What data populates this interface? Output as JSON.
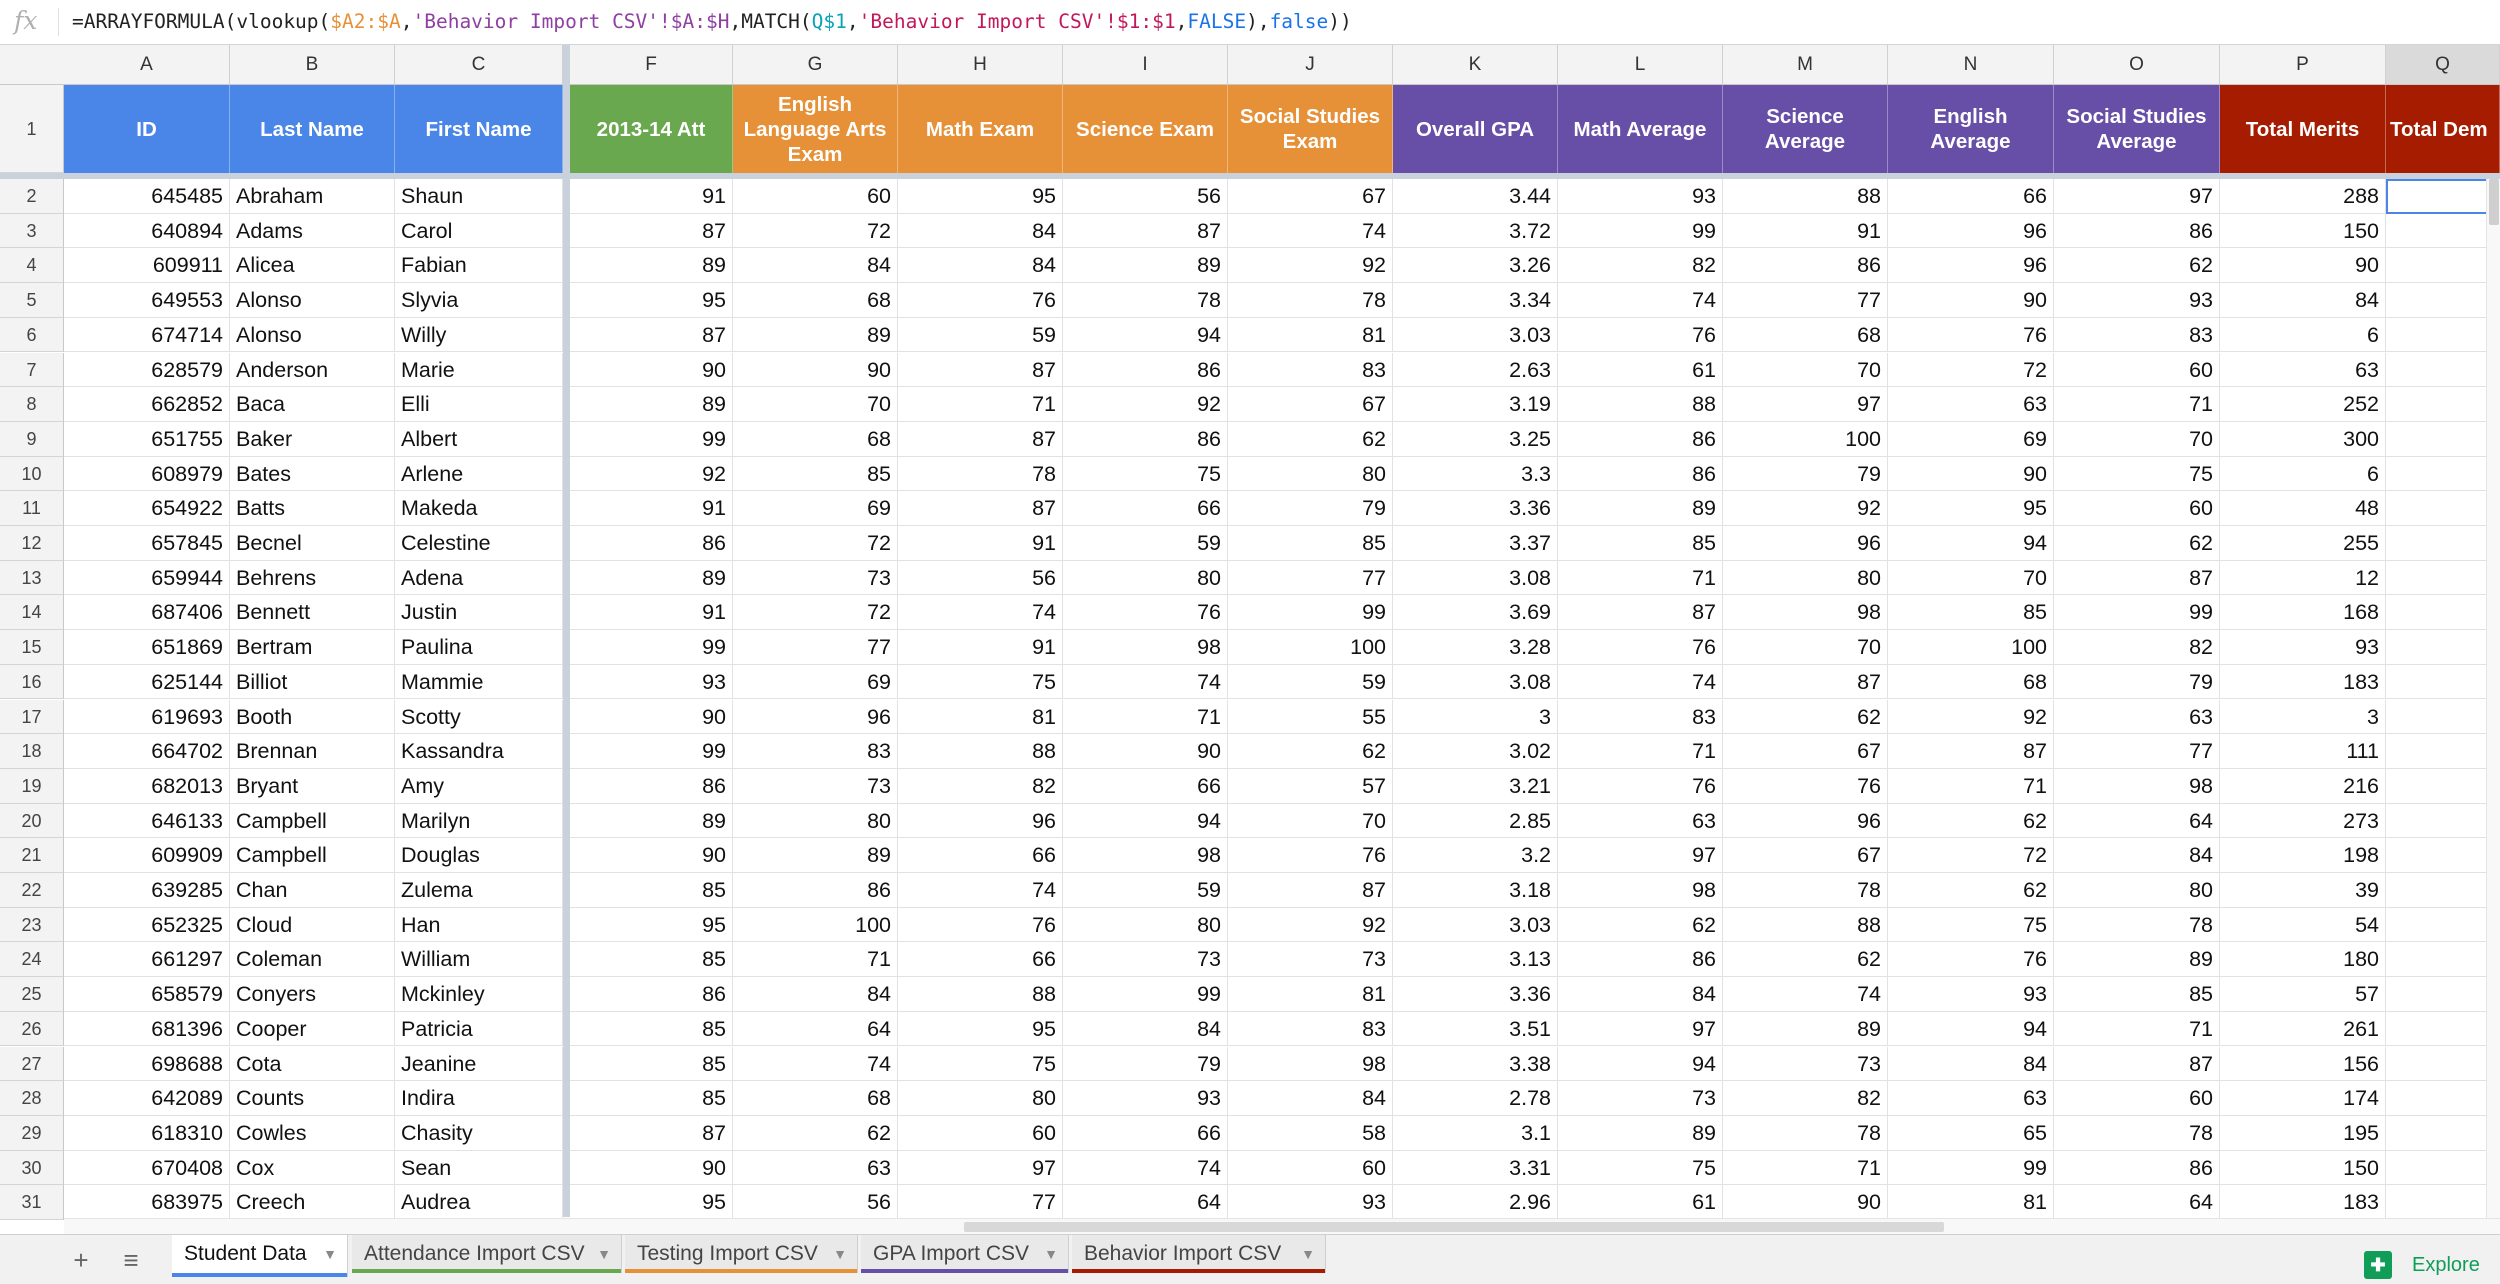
{
  "formula": "=ARRAYFORMULA(vlookup($A2:$A,'Behavior Import CSV'!$A:$H,MATCH(Q$1,'Behavior Import CSV'!$1:$1,FALSE),false))",
  "fx_label": "fx",
  "columns": [
    {
      "letter": "A",
      "header": "ID",
      "color": "#4a86e8"
    },
    {
      "letter": "B",
      "header": "Last Name",
      "color": "#4a86e8"
    },
    {
      "letter": "C",
      "header": "First Name",
      "color": "#4a86e8"
    },
    {
      "letter": "F",
      "header": "2013-14 Att",
      "color": "#6aa84f"
    },
    {
      "letter": "G",
      "header": "English Language Arts Exam",
      "color": "#e69138"
    },
    {
      "letter": "H",
      "header": "Math Exam",
      "color": "#e69138"
    },
    {
      "letter": "I",
      "header": "Science Exam",
      "color": "#e69138"
    },
    {
      "letter": "J",
      "header": "Social Studies Exam",
      "color": "#e69138"
    },
    {
      "letter": "K",
      "header": "Overall GPA",
      "color": "#674ea7"
    },
    {
      "letter": "L",
      "header": "Math Average",
      "color": "#674ea7"
    },
    {
      "letter": "M",
      "header": "Science Average",
      "color": "#674ea7"
    },
    {
      "letter": "N",
      "header": "English Average",
      "color": "#674ea7"
    },
    {
      "letter": "O",
      "header": "Social Studies Average",
      "color": "#674ea7"
    },
    {
      "letter": "P",
      "header": "Total Merits",
      "color": "#a61c00"
    },
    {
      "letter": "Q",
      "header": "Total Dem",
      "color": "#a61c00"
    }
  ],
  "rows": [
    {
      "n": "2",
      "d": [
        "645485",
        "Abraham",
        "Shaun",
        "91",
        "60",
        "95",
        "56",
        "67",
        "3.44",
        "93",
        "88",
        "66",
        "97",
        "288",
        ""
      ]
    },
    {
      "n": "3",
      "d": [
        "640894",
        "Adams",
        "Carol",
        "87",
        "72",
        "84",
        "87",
        "74",
        "3.72",
        "99",
        "91",
        "96",
        "86",
        "150",
        ""
      ]
    },
    {
      "n": "4",
      "d": [
        "609911",
        "Alicea",
        "Fabian",
        "89",
        "84",
        "84",
        "89",
        "92",
        "3.26",
        "82",
        "86",
        "96",
        "62",
        "90",
        ""
      ]
    },
    {
      "n": "5",
      "d": [
        "649553",
        "Alonso",
        "Slyvia",
        "95",
        "68",
        "76",
        "78",
        "78",
        "3.34",
        "74",
        "77",
        "90",
        "93",
        "84",
        ""
      ]
    },
    {
      "n": "6",
      "d": [
        "674714",
        "Alonso",
        "Willy",
        "87",
        "89",
        "59",
        "94",
        "81",
        "3.03",
        "76",
        "68",
        "76",
        "83",
        "6",
        ""
      ]
    },
    {
      "n": "7",
      "d": [
        "628579",
        "Anderson",
        "Marie",
        "90",
        "90",
        "87",
        "86",
        "83",
        "2.63",
        "61",
        "70",
        "72",
        "60",
        "63",
        ""
      ]
    },
    {
      "n": "8",
      "d": [
        "662852",
        "Baca",
        "Elli",
        "89",
        "70",
        "71",
        "92",
        "67",
        "3.19",
        "88",
        "97",
        "63",
        "71",
        "252",
        ""
      ]
    },
    {
      "n": "9",
      "d": [
        "651755",
        "Baker",
        "Albert",
        "99",
        "68",
        "87",
        "86",
        "62",
        "3.25",
        "86",
        "100",
        "69",
        "70",
        "300",
        ""
      ]
    },
    {
      "n": "10",
      "d": [
        "608979",
        "Bates",
        "Arlene",
        "92",
        "85",
        "78",
        "75",
        "80",
        "3.3",
        "86",
        "79",
        "90",
        "75",
        "6",
        ""
      ]
    },
    {
      "n": "11",
      "d": [
        "654922",
        "Batts",
        "Makeda",
        "91",
        "69",
        "87",
        "66",
        "79",
        "3.36",
        "89",
        "92",
        "95",
        "60",
        "48",
        ""
      ]
    },
    {
      "n": "12",
      "d": [
        "657845",
        "Becnel",
        "Celestine",
        "86",
        "72",
        "91",
        "59",
        "85",
        "3.37",
        "85",
        "96",
        "94",
        "62",
        "255",
        ""
      ]
    },
    {
      "n": "13",
      "d": [
        "659944",
        "Behrens",
        "Adena",
        "89",
        "73",
        "56",
        "80",
        "77",
        "3.08",
        "71",
        "80",
        "70",
        "87",
        "12",
        ""
      ]
    },
    {
      "n": "14",
      "d": [
        "687406",
        "Bennett",
        "Justin",
        "91",
        "72",
        "74",
        "76",
        "99",
        "3.69",
        "87",
        "98",
        "85",
        "99",
        "168",
        ""
      ]
    },
    {
      "n": "15",
      "d": [
        "651869",
        "Bertram",
        "Paulina",
        "99",
        "77",
        "91",
        "98",
        "100",
        "3.28",
        "76",
        "70",
        "100",
        "82",
        "93",
        ""
      ]
    },
    {
      "n": "16",
      "d": [
        "625144",
        "Billiot",
        "Mammie",
        "93",
        "69",
        "75",
        "74",
        "59",
        "3.08",
        "74",
        "87",
        "68",
        "79",
        "183",
        ""
      ]
    },
    {
      "n": "17",
      "d": [
        "619693",
        "Booth",
        "Scotty",
        "90",
        "96",
        "81",
        "71",
        "55",
        "3",
        "83",
        "62",
        "92",
        "63",
        "3",
        ""
      ]
    },
    {
      "n": "18",
      "d": [
        "664702",
        "Brennan",
        "Kassandra",
        "99",
        "83",
        "88",
        "90",
        "62",
        "3.02",
        "71",
        "67",
        "87",
        "77",
        "111",
        ""
      ]
    },
    {
      "n": "19",
      "d": [
        "682013",
        "Bryant",
        "Amy",
        "86",
        "73",
        "82",
        "66",
        "57",
        "3.21",
        "76",
        "76",
        "71",
        "98",
        "216",
        ""
      ]
    },
    {
      "n": "20",
      "d": [
        "646133",
        "Campbell",
        "Marilyn",
        "89",
        "80",
        "96",
        "94",
        "70",
        "2.85",
        "63",
        "96",
        "62",
        "64",
        "273",
        ""
      ]
    },
    {
      "n": "21",
      "d": [
        "609909",
        "Campbell",
        "Douglas",
        "90",
        "89",
        "66",
        "98",
        "76",
        "3.2",
        "97",
        "67",
        "72",
        "84",
        "198",
        ""
      ]
    },
    {
      "n": "22",
      "d": [
        "639285",
        "Chan",
        "Zulema",
        "85",
        "86",
        "74",
        "59",
        "87",
        "3.18",
        "98",
        "78",
        "62",
        "80",
        "39",
        ""
      ]
    },
    {
      "n": "23",
      "d": [
        "652325",
        "Cloud",
        "Han",
        "95",
        "100",
        "76",
        "80",
        "92",
        "3.03",
        "62",
        "88",
        "75",
        "78",
        "54",
        ""
      ]
    },
    {
      "n": "24",
      "d": [
        "661297",
        "Coleman",
        "William",
        "85",
        "71",
        "66",
        "73",
        "73",
        "3.13",
        "86",
        "62",
        "76",
        "89",
        "180",
        ""
      ]
    },
    {
      "n": "25",
      "d": [
        "658579",
        "Conyers",
        "Mckinley",
        "86",
        "84",
        "88",
        "99",
        "81",
        "3.36",
        "84",
        "74",
        "93",
        "85",
        "57",
        ""
      ]
    },
    {
      "n": "26",
      "d": [
        "681396",
        "Cooper",
        "Patricia",
        "85",
        "64",
        "95",
        "84",
        "83",
        "3.51",
        "97",
        "89",
        "94",
        "71",
        "261",
        ""
      ]
    },
    {
      "n": "27",
      "d": [
        "698688",
        "Cota",
        "Jeanine",
        "85",
        "74",
        "75",
        "79",
        "98",
        "3.38",
        "94",
        "73",
        "84",
        "87",
        "156",
        ""
      ]
    },
    {
      "n": "28",
      "d": [
        "642089",
        "Counts",
        "Indira",
        "85",
        "68",
        "80",
        "93",
        "84",
        "2.78",
        "73",
        "82",
        "63",
        "60",
        "174",
        ""
      ]
    },
    {
      "n": "29",
      "d": [
        "618310",
        "Cowles",
        "Chasity",
        "87",
        "62",
        "60",
        "66",
        "58",
        "3.1",
        "89",
        "78",
        "65",
        "78",
        "195",
        ""
      ]
    },
    {
      "n": "30",
      "d": [
        "670408",
        "Cox",
        "Sean",
        "90",
        "63",
        "97",
        "74",
        "60",
        "3.31",
        "75",
        "71",
        "99",
        "86",
        "150",
        ""
      ]
    },
    {
      "n": "31",
      "d": [
        "683975",
        "Creech",
        "Audrea",
        "95",
        "56",
        "77",
        "64",
        "93",
        "2.96",
        "61",
        "90",
        "81",
        "64",
        "183",
        ""
      ]
    }
  ],
  "header_row_number": "1",
  "tabs": [
    {
      "label": "Student Data",
      "color": "#4a86e8",
      "active": true
    },
    {
      "label": "Attendance Import CSV",
      "color": "#6aa84f",
      "active": false
    },
    {
      "label": "Testing Import CSV",
      "color": "#e69138",
      "active": false
    },
    {
      "label": "GPA Import CSV",
      "color": "#674ea7",
      "active": false
    },
    {
      "label": "Behavior Import CSV",
      "color": "#a61c00",
      "active": false
    }
  ],
  "add_sheet_icon": "plus-icon",
  "all_sheets_icon": "list-icon",
  "explore_label": "Explore"
}
